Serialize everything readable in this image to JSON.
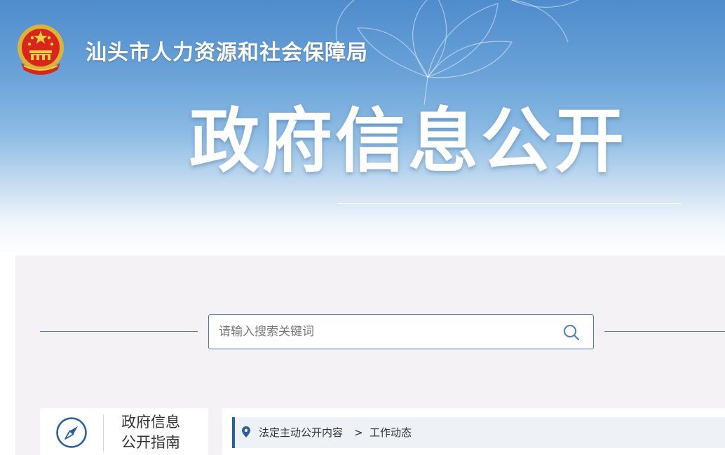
{
  "header": {
    "agency_name": "汕头市人力资源和社会保障局",
    "page_title": "政府信息公开"
  },
  "search": {
    "placeholder": "请输入搜索关键词",
    "value": ""
  },
  "sidebar": {
    "guide_line1": "政府信息",
    "guide_line2": "公开指南"
  },
  "breadcrumb": {
    "items": [
      "法定主动公开内容",
      "工作动态"
    ],
    "separator": ">"
  },
  "colors": {
    "accent_blue": "#2a5f9e",
    "border_blue": "#4b7db5",
    "banner_blue": "#4f8ccc",
    "panel_bg": "#f5f2f5"
  },
  "icons": {
    "emblem": "national-emblem-icon",
    "search": "search-icon",
    "guide": "compass-icon",
    "location": "location-pin-icon"
  }
}
